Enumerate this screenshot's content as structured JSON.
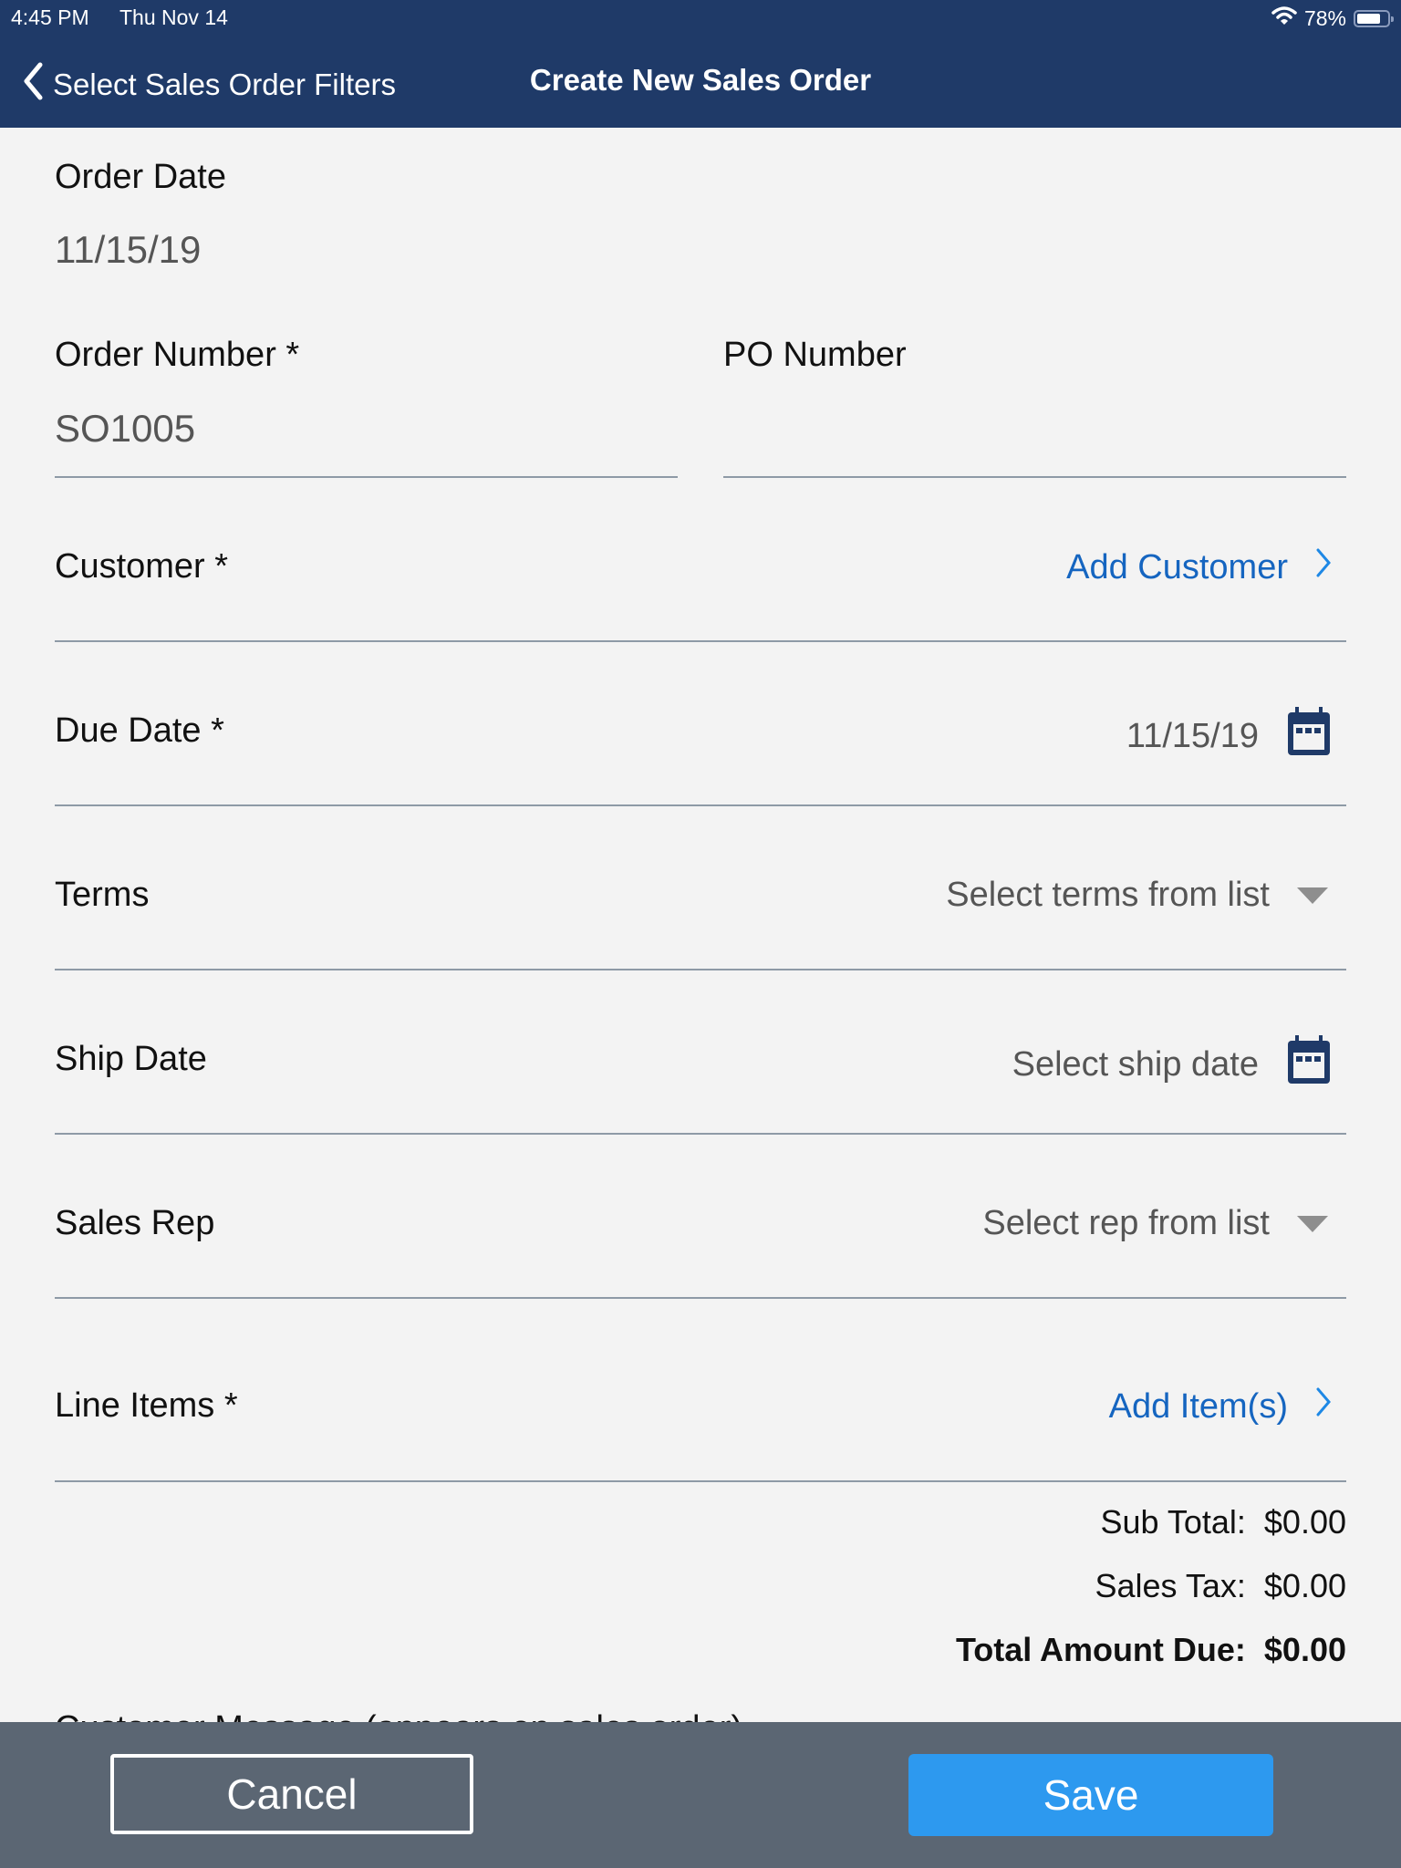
{
  "status_bar": {
    "time": "4:45 PM",
    "date": "Thu Nov 14",
    "battery_percent_label": "78%",
    "battery_level": 0.78,
    "wifi_icon": "wifi-icon",
    "battery_icon": "battery-icon"
  },
  "nav": {
    "back_label": "Select Sales Order Filters",
    "back_icon": "chevron-left-icon",
    "title": "Create New Sales Order"
  },
  "form": {
    "order_date": {
      "label": "Order Date",
      "value": "11/15/19"
    },
    "order_number": {
      "label": "Order Number *",
      "value": "SO1005"
    },
    "po_number": {
      "label": "PO Number",
      "value": ""
    },
    "customer": {
      "label": "Customer *",
      "action": "Add Customer",
      "icon": "chevron-right-icon"
    },
    "due_date": {
      "label": "Due Date *",
      "value": "11/15/19",
      "icon": "calendar-icon"
    },
    "terms": {
      "label": "Terms",
      "placeholder": "Select terms from list",
      "icon": "dropdown-caret-icon"
    },
    "ship_date": {
      "label": "Ship Date",
      "placeholder": "Select ship date",
      "icon": "calendar-icon"
    },
    "sales_rep": {
      "label": "Sales Rep",
      "placeholder": "Select rep from list",
      "icon": "dropdown-caret-icon"
    },
    "line_items": {
      "label": "Line Items *",
      "action": "Add Item(s)",
      "icon": "chevron-right-icon"
    },
    "customer_message": {
      "label": "Customer Message (appears on sales order)"
    }
  },
  "totals": {
    "sub_total": {
      "label": "Sub Total:",
      "value": "$0.00"
    },
    "sales_tax": {
      "label": "Sales Tax:",
      "value": "$0.00"
    },
    "total_due": {
      "label": "Total Amount Due:",
      "value": "$0.00"
    }
  },
  "footer": {
    "cancel_label": "Cancel",
    "save_label": "Save"
  },
  "colors": {
    "nav_bg": "#1f3a68",
    "link": "#1565c0",
    "save_bg": "#2d99ef",
    "footer_bg": "#5b6673",
    "page_bg": "#f3f3f3"
  }
}
